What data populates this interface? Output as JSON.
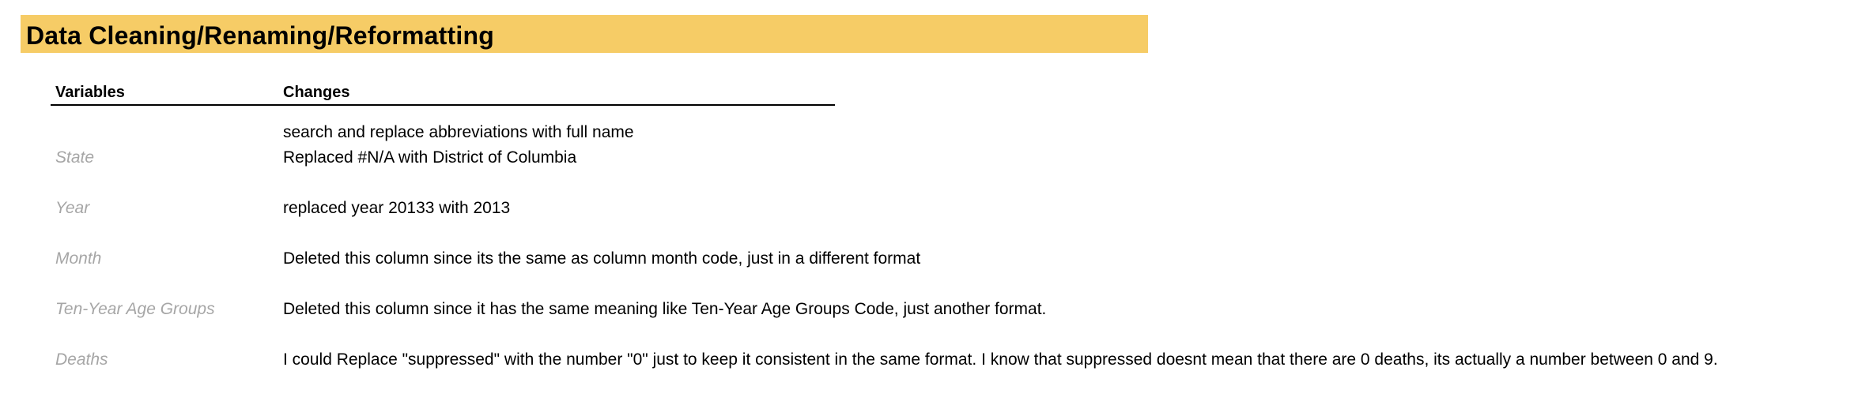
{
  "title": "Data Cleaning/Renaming/Reformatting",
  "colors": {
    "banner": "#F6CC66",
    "variable_text": "#A6A6A6",
    "change_text": "#000000"
  },
  "table": {
    "headers": {
      "variables": "Variables",
      "changes": "Changes"
    },
    "rows": [
      {
        "variable": "State",
        "changes": [
          "search and replace abbreviations with full name",
          "Replaced #N/A with District of Columbia"
        ]
      },
      {
        "variable": "Year",
        "changes": [
          "replaced year 20133 with 2013"
        ]
      },
      {
        "variable": "Month",
        "changes": [
          "Deleted this column since its the same as column month code, just in a different format"
        ]
      },
      {
        "variable": "Ten-Year Age Groups",
        "changes": [
          "Deleted this column since it has the same meaning like Ten-Year Age Groups Code, just another format."
        ]
      },
      {
        "variable": "Deaths",
        "changes": [
          "I could Replace \"suppressed\" with the number \"0\" just to keep it consistent in the same format. I know that suppressed doesnt mean that there are 0 deaths, its actually a number between 0 and 9."
        ]
      }
    ]
  }
}
